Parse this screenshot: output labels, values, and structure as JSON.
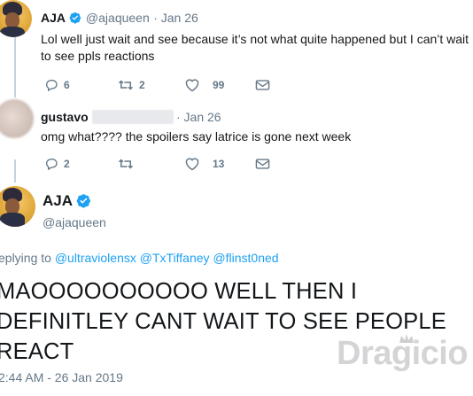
{
  "tweet1": {
    "name": "AJA",
    "handle": "@ajaqueen",
    "date": "· Jan 26",
    "text_line1": "Lol well just wait and see because it’s not what quite happened but I can’t wait",
    "text_line2": "to see ppls reactions",
    "reply_count": "6",
    "retweet_count": "2",
    "like_count": "99"
  },
  "tweet2": {
    "name": "gustavo",
    "date": "· Jan 26",
    "text": "omg what???? the spoilers say latrice is gone next week",
    "reply_count": "2",
    "retweet_count": "",
    "like_count": "13"
  },
  "main_tweet": {
    "name": "AJA",
    "handle": "@ajaqueen",
    "replying_prefix": "eplying to ",
    "mentions": "@ultraviolensx @TxTiffaney @flinst0ned",
    "text_line1": "MAOOOOOOOOOO WELL THEN I",
    "text_line2": "DEFINITLEY CANT WAIT TO SEE PEOPLE",
    "text_line3": "REACT",
    "timestamp": "2:44 AM - 26 Jan 2019"
  },
  "watermark": "Dragicio",
  "colors": {
    "thread_line": "#c3d4e0",
    "verified": "#1da1f2",
    "link": "#1da1f2",
    "muted": "#657786"
  }
}
